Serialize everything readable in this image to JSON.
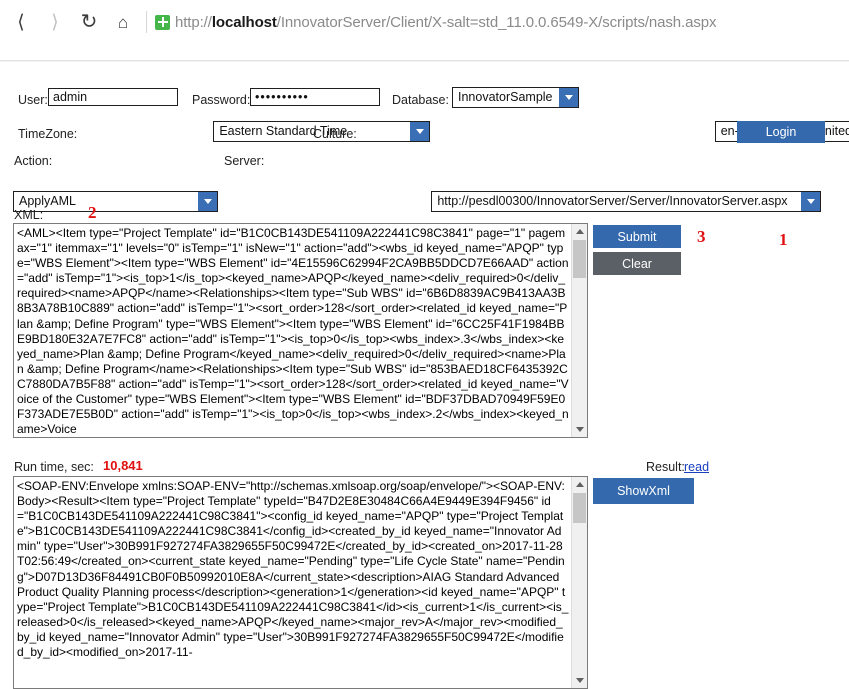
{
  "browser": {
    "back_icon": "chevron-left-icon",
    "forward_icon": "chevron-right-icon",
    "reload_icon": "reload-icon",
    "home_icon": "home-icon",
    "security_icon": "green-shield-plus-icon",
    "url_prefix": "http://",
    "url_host": "localhost",
    "url_rest": "/InnovatorServer/Client/X-salt=std_11.0.0.6549-X/scripts/nash.aspx"
  },
  "form": {
    "user_label": "User:",
    "user_value": "admin",
    "password_label": "Password:",
    "password_value": "••••••••••",
    "database_label": "Database:",
    "database_value": "InnovatorSample",
    "timezone_label": "TimeZone:",
    "timezone_value": "Eastern Standard Time",
    "culture_label": "Culture:",
    "culture_value": "en-US - English (United States)",
    "login_label": "Login",
    "action_label": "Action:",
    "action_value": "ApplyAML",
    "server_label": "Server:",
    "server_value": "http://pesdl00300/InnovatorServer/Server/InnovatorServer.aspx",
    "xml_label": "XML:"
  },
  "markers": {
    "one": "1",
    "two": "2",
    "three": "3"
  },
  "actions": {
    "submit_label": "Submit",
    "clear_label": "Clear",
    "showxml_label": "ShowXml"
  },
  "status": {
    "runtime_label": "Run time, sec:",
    "runtime_value": "10,841",
    "result_label": "Result:",
    "result_link": "read"
  },
  "xml_input": "<AML><Item type=\"Project Template\" id=\"B1C0CB143DE541109A222441C98C3841\" page=\"1\" pagemax=\"1\" itemmax=\"1\" levels=\"0\" isTemp=\"1\" isNew=\"1\" action=\"add\"><wbs_id keyed_name=\"APQP\" type=\"WBS Element\"><Item type=\"WBS Element\" id=\"4E15596C62994F2CA9BB5DDCD7E66AAD\" action=\"add\" isTemp=\"1\"><is_top>1</is_top><keyed_name>APQP</keyed_name><deliv_required>0</deliv_required><name>APQP</name><Relationships><Item type=\"Sub WBS\" id=\"6B6D8839AC9B413AA3B8B3A78B10C889\" action=\"add\" isTemp=\"1\"><sort_order>128</sort_order><related_id keyed_name=\"Plan &amp; Define Program\" type=\"WBS Element\"><Item type=\"WBS Element\" id=\"6CC25F41F1984BBE9BD180E32A7E7FC8\" action=\"add\" isTemp=\"1\"><is_top>0</is_top><wbs_index>.3</wbs_index><keyed_name>Plan &amp; Define Program</keyed_name><deliv_required>0</deliv_required><name>Plan &amp; Define Program</name><Relationships><Item type=\"Sub WBS\" id=\"853BAED18CF6435392CC7880DA7B5F88\" action=\"add\" isTemp=\"1\"><sort_order>128</sort_order><related_id keyed_name=\"Voice of the Customer\" type=\"WBS Element\"><Item type=\"WBS Element\" id=\"BDF37DBAD70949F59E0F373ADE7E5B0D\" action=\"add\" isTemp=\"1\"><is_top>0</is_top><wbs_index>.2</wbs_index><keyed_name>Voice",
  "xml_result": "<SOAP-ENV:Envelope xmlns:SOAP-ENV=\"http://schemas.xmlsoap.org/soap/envelope/\"><SOAP-ENV:Body><Result><Item type=\"Project Template\" typeId=\"B47D2E8E30484C66A4E9449E394F9456\" id=\"B1C0CB143DE541109A222441C98C3841\"><config_id keyed_name=\"APQP\" type=\"Project Template\">B1C0CB143DE541109A222441C98C3841</config_id><created_by_id keyed_name=\"Innovator Admin\" type=\"User\">30B991F927274FA3829655F50C99472E</created_by_id><created_on>2017-11-28T02:56:49</created_on><current_state keyed_name=\"Pending\" type=\"Life Cycle State\" name=\"Pending\">D07D13D36F84491CB0F0B50992010E8A</current_state><description>AIAG Standard Advanced Product Quality Planning process</description><generation>1</generation><id keyed_name=\"APQP\" type=\"Project Template\">B1C0CB143DE541109A222441C98C3841</id><is_current>1</is_current><is_released>0</is_released><keyed_name>APQP</keyed_name><major_rev>A</major_rev><modified_by_id keyed_name=\"Innovator Admin\" type=\"User\">30B991F927274FA3829655F50C99472E</modified_by_id><modified_on>2017-11-"
}
